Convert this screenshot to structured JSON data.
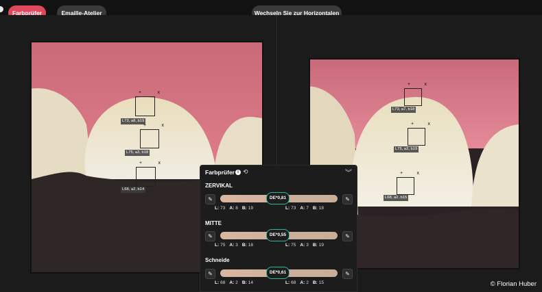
{
  "toolbar": {
    "tab_active": "Farbprüfer",
    "tab_other": "Emaille-Atelier",
    "orientation_button": "Wechseln Sie zur Horizontalen"
  },
  "left_image": {
    "samples": [
      {
        "label": "L73, a8, b19"
      },
      {
        "label": "L75, a3, b18"
      },
      {
        "label": "L68, a2, b14"
      }
    ]
  },
  "right_image": {
    "samples": [
      {
        "label": "L73, a7, b18"
      },
      {
        "label": "L75, a3, b19"
      },
      {
        "label": "L68, a2, b15"
      }
    ]
  },
  "panel": {
    "title": "Farbprüfer",
    "icons": [
      "info-icon",
      "refresh-icon",
      "chevron-double-down-icon",
      "eyedropper-icon"
    ],
    "sections": [
      {
        "name": "ZERVIKAL",
        "de": "DE*0,81",
        "left": {
          "L": "73",
          "A": "8",
          "B": "19"
        },
        "right": {
          "L": "73",
          "A": "7",
          "B": "18"
        }
      },
      {
        "name": "MITTE",
        "de": "DE*0,55",
        "left": {
          "L": "75",
          "A": "3",
          "B": "18"
        },
        "right": {
          "L": "75",
          "A": "3",
          "B": "19"
        }
      },
      {
        "name": "Schneide",
        "de": "DE*0,61",
        "left": {
          "L": "68",
          "A": "2",
          "B": "14"
        },
        "right": {
          "L": "68",
          "A": "2",
          "B": "15"
        }
      }
    ],
    "labels": {
      "l": "L:",
      "a": "A:",
      "b": "B:"
    }
  },
  "credit": "© Florian Huber",
  "colors": {
    "accent": "#e0485c",
    "badge_ring": "#2fb79e",
    "gum": "#d9737f",
    "tooth": "#e8e2cf"
  }
}
